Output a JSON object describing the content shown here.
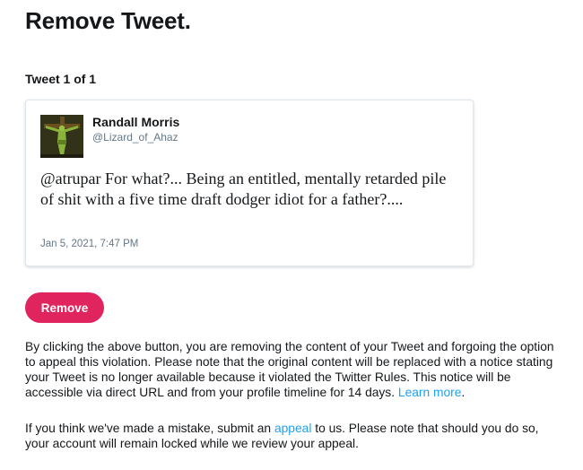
{
  "page": {
    "title": "Remove Tweet.",
    "tweet_counter": "Tweet 1 of 1"
  },
  "tweet": {
    "author_name": "Randall Morris",
    "author_handle": "@Lizard_of_Ahaz",
    "text": "@atrupar For what?... Being an entitled, mentally retarded pile of shit with a five time draft dodger idiot for a father?....",
    "timestamp": "Jan 5, 2021, 7:47 PM"
  },
  "actions": {
    "remove_label": "Remove"
  },
  "notices": {
    "paragraph1_text": "By clicking the above button, you are removing the content of your Tweet and forgoing the option to appeal this violation. Please note that the original content will be replaced with a notice stating your Tweet is no longer available because it violated the Twitter Rules. This notice will be accessible via direct URL and from your profile timeline for 14 days.",
    "paragraph1_link": "Learn more",
    "paragraph1_end": ".",
    "paragraph2_before": "If you think we've made a mistake, submit an",
    "paragraph2_link": "appeal",
    "paragraph2_after": "to us. Please note that should you do so, your account will remain locked while we review your appeal."
  },
  "colors": {
    "accent_pink": "#e0245e",
    "link_blue": "#1da1f2",
    "muted_gray": "#657786",
    "text_dark": "#14171a"
  },
  "icons": {
    "avatar": "crucifix-avatar-image"
  }
}
